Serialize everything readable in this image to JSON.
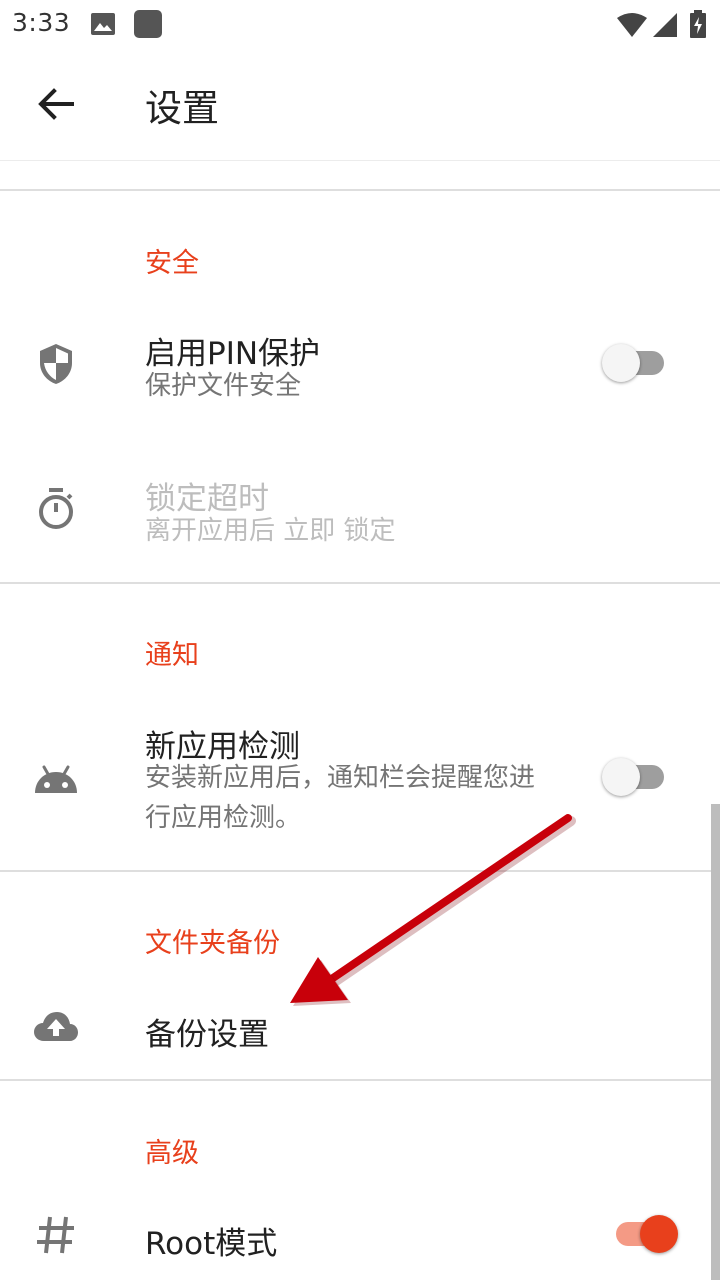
{
  "status_bar": {
    "time": "3:33"
  },
  "app_bar": {
    "title": "设置"
  },
  "sections": {
    "security": {
      "title": "安全",
      "pin": {
        "title": "启用PIN保护",
        "summary": "保护文件安全",
        "enabled": false
      },
      "lock_timeout": {
        "title": "锁定超时",
        "summary": "离开应用后 立即 锁定"
      }
    },
    "notification": {
      "title": "通知",
      "new_app": {
        "title": "新应用检测",
        "summary": "安装新应用后，通知栏会提醒您进行应用检测。",
        "enabled": false
      }
    },
    "backup": {
      "title": "文件夹备份",
      "settings": {
        "title": "备份设置"
      }
    },
    "advanced": {
      "title": "高级",
      "root": {
        "title": "Root模式",
        "enabled": true
      }
    }
  },
  "colors": {
    "accent": "#e8401c",
    "arrow": "#c8000a"
  }
}
